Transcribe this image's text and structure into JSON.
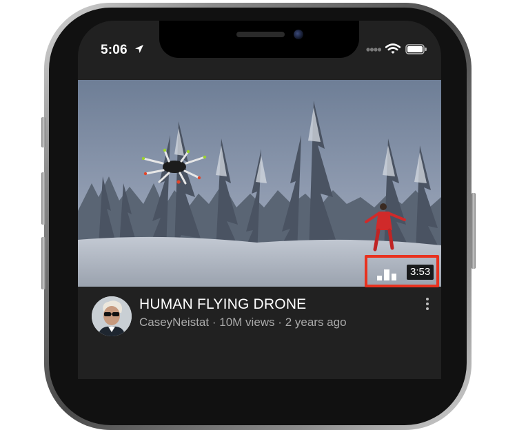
{
  "status_bar": {
    "time": "5:06",
    "location_icon": "location-arrow-icon",
    "signal_icon": "cellular-signal-icon",
    "wifi_icon": "wifi-icon",
    "battery_icon": "battery-icon"
  },
  "video": {
    "thumbnail_icon": "video-thumbnail",
    "stats_icon": "bar-chart-icon",
    "duration": "3:53",
    "highlight_color": "#e8321f"
  },
  "metadata": {
    "title": "HUMAN FLYING DRONE",
    "channel": "CaseyNeistat",
    "views": "10M views",
    "age": "2 years ago",
    "separator": "·",
    "avatar_icon": "channel-avatar",
    "more_icon": "more-vertical-icon"
  },
  "colors": {
    "background": "#212121",
    "title_text": "#ffffff",
    "meta_text": "#aaaaaa"
  }
}
